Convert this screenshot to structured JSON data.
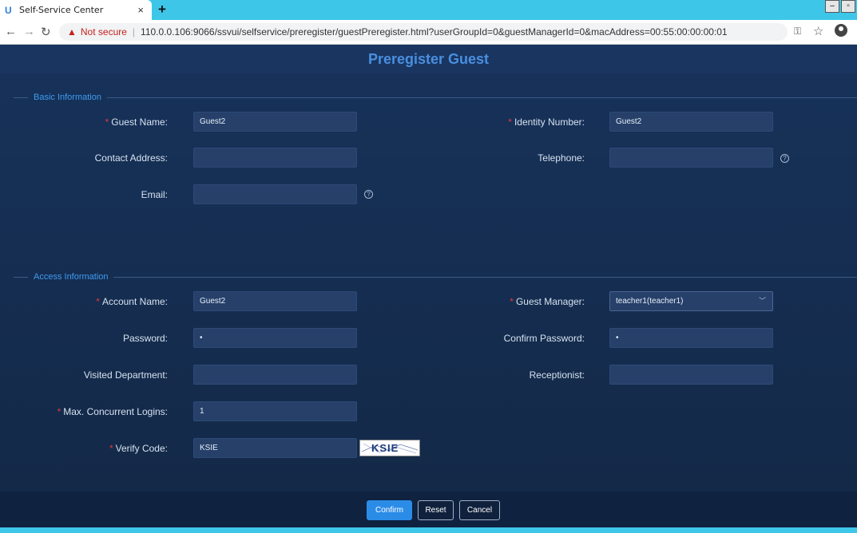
{
  "browser": {
    "tab_title": "Self-Service Center",
    "tab_close": "×",
    "new_tab": "+",
    "security_label": "Not secure",
    "url": "110.0.0.106:9066/ssvui/selfservice/preregister/guestPreregister.html?userGroupId=0&guestManagerId=0&macAddress=00:55:00:00:00:01"
  },
  "page": {
    "title": "Preregister Guest"
  },
  "basic": {
    "section_title": "Basic Information",
    "guest_name": {
      "label": "Guest Name:",
      "value": "Guest2"
    },
    "identity_number": {
      "label": "Identity Number:",
      "value": "Guest2"
    },
    "contact_address": {
      "label": "Contact Address:",
      "value": ""
    },
    "telephone": {
      "label": "Telephone:",
      "value": ""
    },
    "email": {
      "label": "Email:",
      "value": ""
    }
  },
  "access": {
    "section_title": "Access Information",
    "account_name": {
      "label": "Account Name:",
      "value": "Guest2"
    },
    "guest_manager": {
      "label": "Guest Manager:",
      "value": "teacher1(teacher1)"
    },
    "password": {
      "label": "Password:",
      "value": "•"
    },
    "confirm_password": {
      "label": "Confirm Password:",
      "value": "•"
    },
    "visited_department": {
      "label": "Visited Department:",
      "value": ""
    },
    "receptionist": {
      "label": "Receptionist:",
      "value": ""
    },
    "max_logins": {
      "label": "Max. Concurrent Logins:",
      "value": "1"
    },
    "verify_code": {
      "label": "Verify Code:",
      "value": "KSIE"
    },
    "captcha_text": "KSIE"
  },
  "buttons": {
    "confirm": "Confirm",
    "reset": "Reset",
    "cancel": "Cancel"
  },
  "required_marker": "*",
  "help_glyph": "?",
  "colors": {
    "accent": "#2b8ce8",
    "required": "#e0383e",
    "section": "#3e9cf0",
    "browser_bar": "#3ec6e8"
  }
}
